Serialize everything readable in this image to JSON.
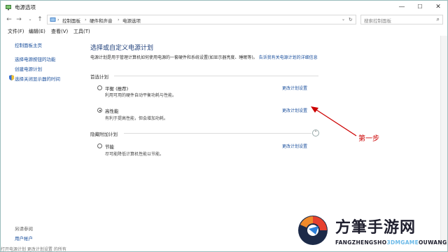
{
  "window": {
    "title": "电源选项",
    "minimize": "—",
    "maximize": "☐",
    "close": "✕"
  },
  "addressbar": {
    "breadcrumbs": [
      "控制面板",
      "硬件和声音",
      "电源选项"
    ],
    "search_placeholder": "搜索控制面板"
  },
  "menubar": {
    "items": [
      "文件(F)",
      "编辑(E)",
      "查看(V)",
      "工具(T)"
    ]
  },
  "sidebar": {
    "items": [
      {
        "label": "控制面板主页"
      },
      {
        "label": "选择电源按钮的功能"
      },
      {
        "label": "创建电源计划"
      },
      {
        "label": "选择关闭显示器的时间"
      }
    ],
    "see_also": "另请参阅",
    "user_accounts": "用户帐户"
  },
  "main": {
    "heading": "选择或自定义电源计划",
    "description": "电源计划是用于管理计算机如何使用电源的一套硬件和系统设置(如显示器亮度、睡眠等)。",
    "description_link": "告诉我有关电源计划的详细信息",
    "preferred_label": "首选计划",
    "hidden_label": "隐藏附加计划",
    "change_link": "更改计划设置",
    "plans": [
      {
        "name": "平衡 (推荐)",
        "desc": "利用可用的硬件自动平衡功耗与性能。",
        "selected": false
      },
      {
        "name": "高性能",
        "desc": "有利于提高性能，但会增加功耗。",
        "selected": true
      },
      {
        "name": "节能",
        "desc": "尽可能降低计算机性能以节能。",
        "selected": false
      }
    ]
  },
  "annotation": {
    "text": "第一步",
    "color": "#cc0000"
  },
  "watermark": {
    "brand": "方筆手游网",
    "domain_prefix": "FANGZHENGSHO",
    "domain_highlight": "3DMGAME",
    "domain_suffix": "OUWANG"
  },
  "status_snippet": "打开电源计划 更改计划设置 的所有"
}
